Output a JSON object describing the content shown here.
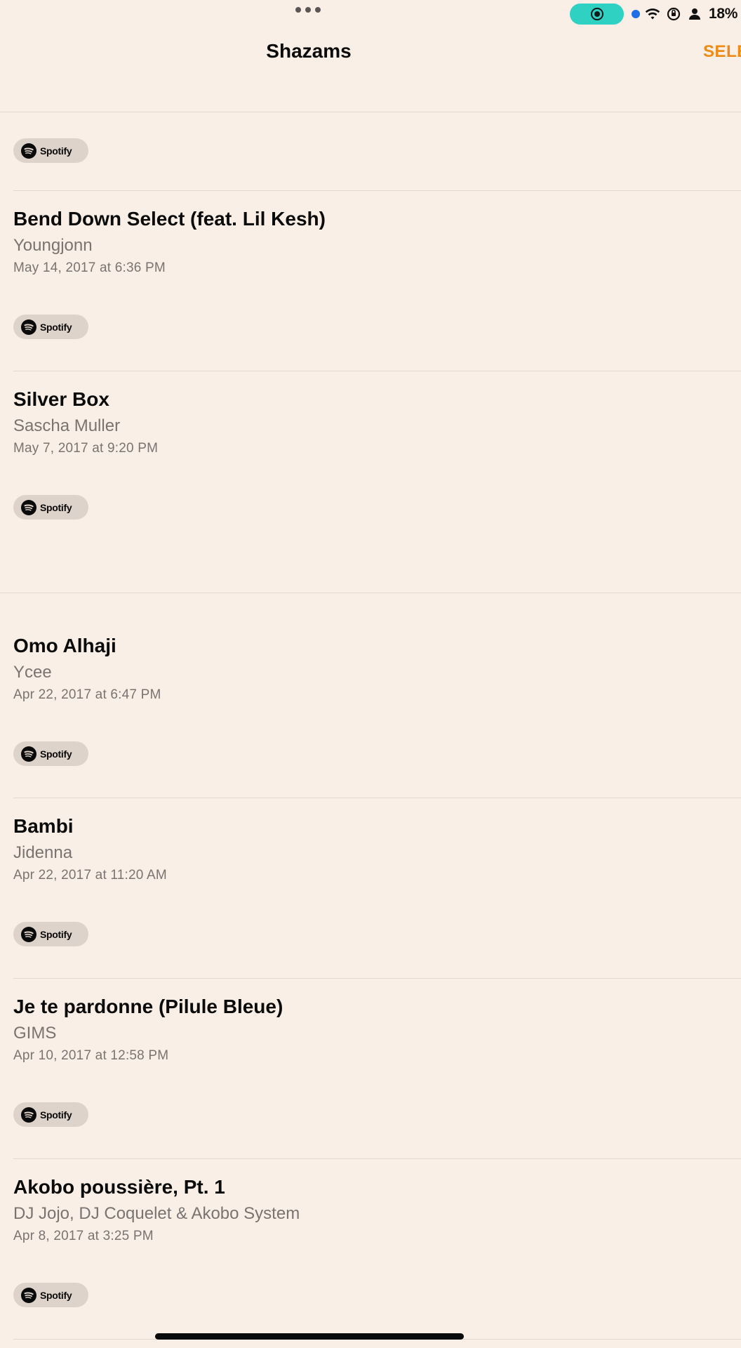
{
  "status_bar": {
    "battery_percent": "18%",
    "icons": [
      "more-dots-icon",
      "screen-record-icon",
      "location-dot-icon",
      "wifi-icon",
      "orientation-lock-icon",
      "person-icon",
      "battery-icon"
    ],
    "record_pill_color": "#2fd1c2",
    "battery_color": "#b83fb3"
  },
  "nav": {
    "title": "Shazams",
    "select_label": "SELE",
    "accent_color": "#f08a16"
  },
  "spotify_label": "Spotify",
  "top_stub": {
    "button_label": "Spotify"
  },
  "items": [
    {
      "title": "Bend Down Select (feat. Lil Kesh)",
      "artist": "Youngjonn",
      "date": "May 14, 2017 at 6:36 PM",
      "button_label": "Spotify"
    },
    {
      "title": "Silver Box",
      "artist": "Sascha Muller",
      "date": "May 7, 2017 at 9:20 PM",
      "button_label": "Spotify"
    },
    {
      "title": "Omo Alhaji",
      "artist": "Ycee",
      "date": "Apr 22, 2017 at 6:47 PM",
      "button_label": "Spotify"
    },
    {
      "title": "Bambi",
      "artist": "Jidenna",
      "date": "Apr 22, 2017 at 11:20 AM",
      "button_label": "Spotify"
    },
    {
      "title": "Je te pardonne (Pilule Bleue)",
      "artist": "GIMS",
      "date": "Apr 10, 2017 at 12:58 PM",
      "button_label": "Spotify"
    },
    {
      "title": "Akobo poussière, Pt. 1",
      "artist": "DJ Jojo, DJ Coquelet & Akobo System",
      "date": "Apr 8, 2017 at 3:25 PM",
      "button_label": "Spotify"
    }
  ]
}
